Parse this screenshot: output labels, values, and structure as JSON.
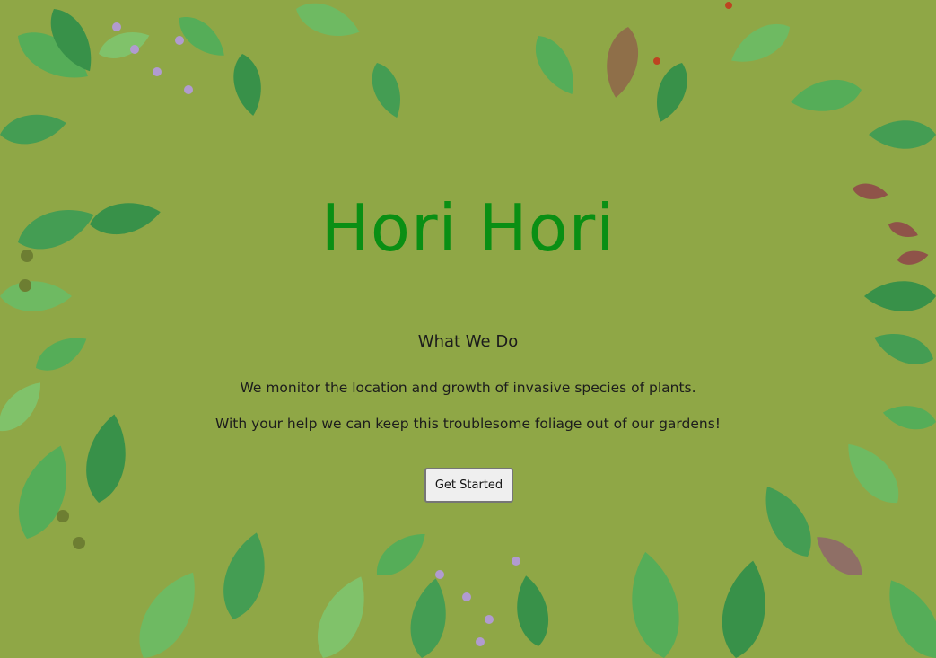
{
  "hero": {
    "title": "Hori Hori",
    "section_heading": "What We Do",
    "paragraph_1": "We monitor the location and growth of invasive species of plants.",
    "paragraph_2": "With your help we can keep this troublesome foliage out of our gardens!",
    "cta_label": "Get Started"
  },
  "colors": {
    "background": "#8fa746",
    "title": "#0a8f14",
    "text": "#1c1c1c",
    "button_bg": "#efefef",
    "leaf_dark": "#2f8f4a",
    "leaf_mid": "#4fae5a",
    "leaf_light": "#7fc66e",
    "leaf_red": "#8f4a4a",
    "flower_lilac": "#b59ae0"
  },
  "background_art": "watercolor-leaves-border"
}
